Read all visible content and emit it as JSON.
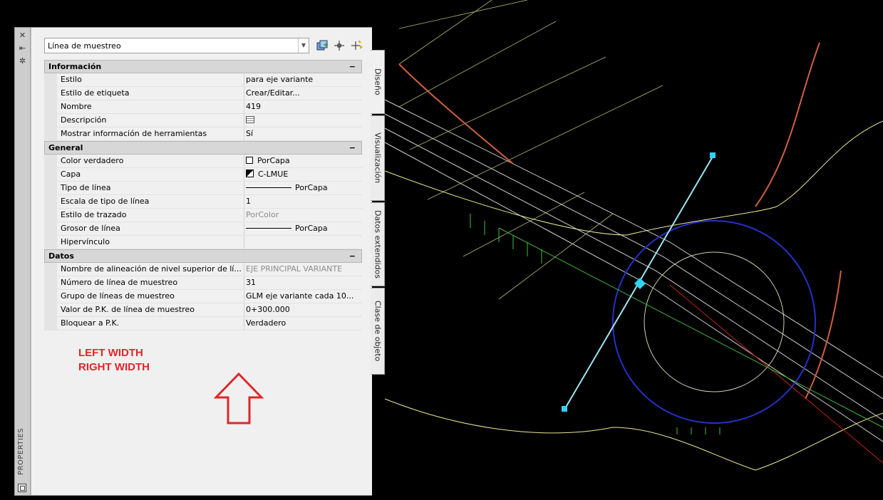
{
  "palette": {
    "title": "PROPERTIES",
    "selector": {
      "value": "Línea de muestreo"
    },
    "categories": [
      {
        "name": "Información",
        "toggle": "−",
        "rows": [
          {
            "name": "Estilo",
            "value": "para eje variante"
          },
          {
            "name": "Estilo de etiqueta",
            "value": "Crear/Editar..."
          },
          {
            "name": "Nombre",
            "value": "419"
          },
          {
            "name": "Descripción",
            "value": ""
          },
          {
            "name": "Mostrar información de herramientas",
            "value": "Sí"
          }
        ]
      },
      {
        "name": "General",
        "toggle": "−",
        "rows": [
          {
            "name": "Color verdadero",
            "value": "PorCapa"
          },
          {
            "name": "Capa",
            "value": "C-LMUE"
          },
          {
            "name": "Tipo de línea",
            "value": "PorCapa"
          },
          {
            "name": "Escala de tipo de línea",
            "value": "1"
          },
          {
            "name": "Estilo de trazado",
            "value": "PorColor"
          },
          {
            "name": "Grosor de línea",
            "value": "PorCapa"
          },
          {
            "name": "Hipervínculo",
            "value": ""
          }
        ]
      },
      {
        "name": "Datos",
        "toggle": "−",
        "rows": [
          {
            "name": "Nombre de alineación de nivel superior de lí...",
            "value": "EJE PRINCIPAL VARIANTE"
          },
          {
            "name": "Número de línea de muestreo",
            "value": "31"
          },
          {
            "name": "Grupo de líneas de muestreo",
            "value": "GLM eje variante cada 10..."
          },
          {
            "name": "Valor de P.K. de línea de muestreo",
            "value": "0+300.000"
          },
          {
            "name": "Bloquear a P.K.",
            "value": "Verdadero"
          }
        ]
      }
    ],
    "tabs": [
      "Diseño",
      "Visualización",
      "Datos extendidos",
      "Clase de objeto"
    ]
  },
  "annotation": {
    "line1": "LEFT WIDTH",
    "line2": "RIGHT WIDTH",
    "color": "#e0262a"
  }
}
